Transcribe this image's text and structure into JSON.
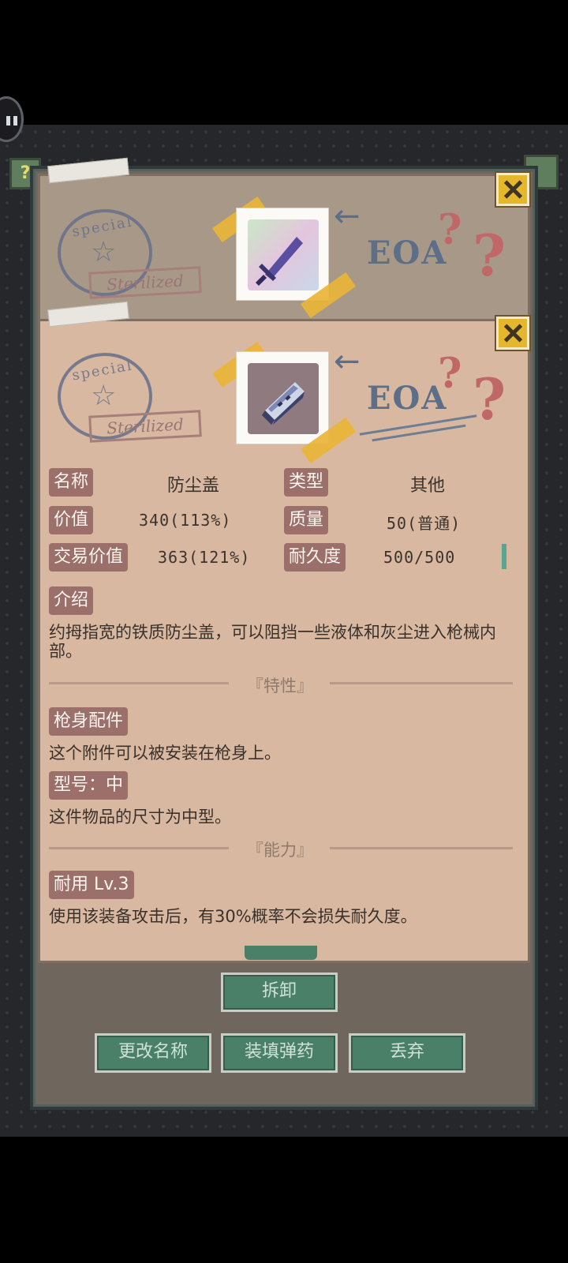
{
  "item": {
    "name_label": "名称",
    "name_value": "防尘盖",
    "type_label": "类型",
    "type_value": "其他",
    "value_label": "价值",
    "value_value": "340(113%)",
    "quality_label": "质量",
    "quality_value": "50(普通)",
    "trade_label": "交易价值",
    "trade_value": "363(121%)",
    "durability_label": "耐久度",
    "durability_value": "500/500",
    "intro_label": "介绍",
    "intro_text": "约拇指宽的铁质防尘盖，可以阻挡一些液体和灰尘进入枪械内部。"
  },
  "traits": {
    "section_title": "『特性』",
    "items": [
      {
        "label": "枪身配件",
        "desc": "这个附件可以被安装在枪身上。"
      },
      {
        "label": "型号：中",
        "desc": "这件物品的尺寸为中型。"
      }
    ]
  },
  "abilities": {
    "section_title": "『能力』",
    "items": [
      {
        "label": "耐用 Lv.3",
        "desc": "使用该装备攻击后，有30%概率不会损失耐久度。"
      }
    ]
  },
  "card_decor": {
    "stamp_text": "special",
    "sterilized": "Sterilized",
    "eoa": "EOA",
    "badge_q": "?"
  },
  "actions": {
    "unequip": "拆卸",
    "rename": "更改名称",
    "load_ammo": "装填弹药",
    "discard": "丢弃"
  },
  "colors": {
    "card": "#d8b8a0",
    "chip": "#9b6f6a",
    "button": "#4b8068",
    "durability": "#5aa58f"
  }
}
